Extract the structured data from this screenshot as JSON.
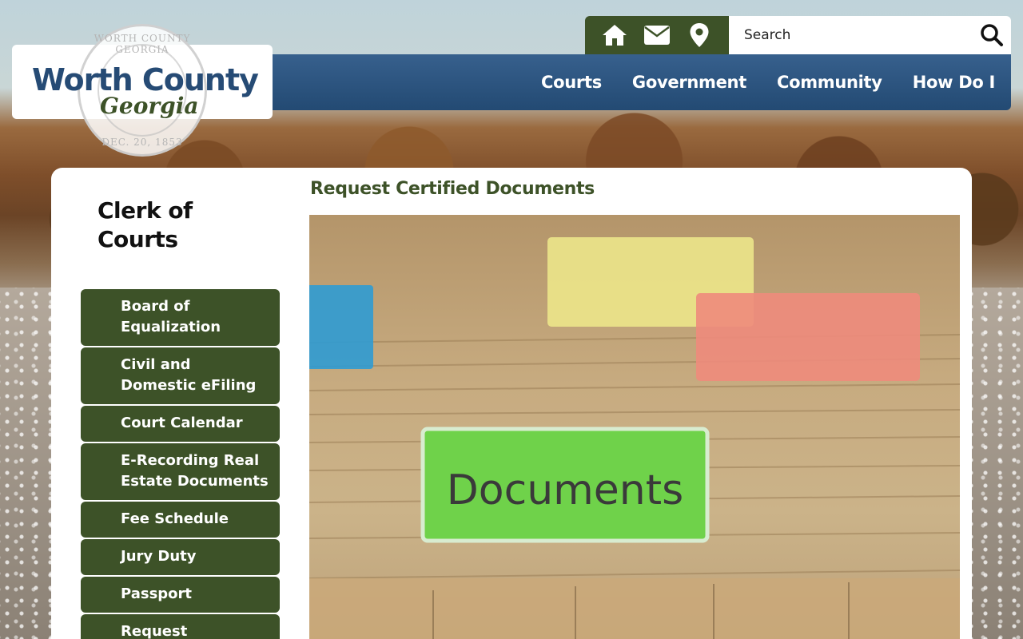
{
  "logo": {
    "title": "Worth County",
    "subtitle": "Georgia",
    "seal_top": "WORTH COUNTY GEORGIA",
    "seal_bottom": "DEC. 20, 1853"
  },
  "utility": {
    "icons": [
      "home-icon",
      "envelope-icon",
      "map-pin-icon"
    ],
    "search_placeholder": "Search"
  },
  "nav": {
    "items": [
      {
        "label": "Courts"
      },
      {
        "label": "Government"
      },
      {
        "label": "Community"
      },
      {
        "label": "How Do I"
      }
    ]
  },
  "sidebar": {
    "title": "Clerk of Courts",
    "items": [
      {
        "label": "Board of Equalization"
      },
      {
        "label": "Civil and Domestic eFiling"
      },
      {
        "label": "Court Calendar"
      },
      {
        "label": "E-Recording Real Estate Documents"
      },
      {
        "label": "Fee Schedule"
      },
      {
        "label": "Jury Duty"
      },
      {
        "label": "Passport"
      },
      {
        "label": "Request"
      }
    ]
  },
  "main": {
    "heading": "Request Certified Documents",
    "image_tab_text": "Documents",
    "colors": {
      "nav_blue": "#2c5480",
      "brand_green": "#3d5228",
      "logo_blue": "#264b75"
    }
  }
}
